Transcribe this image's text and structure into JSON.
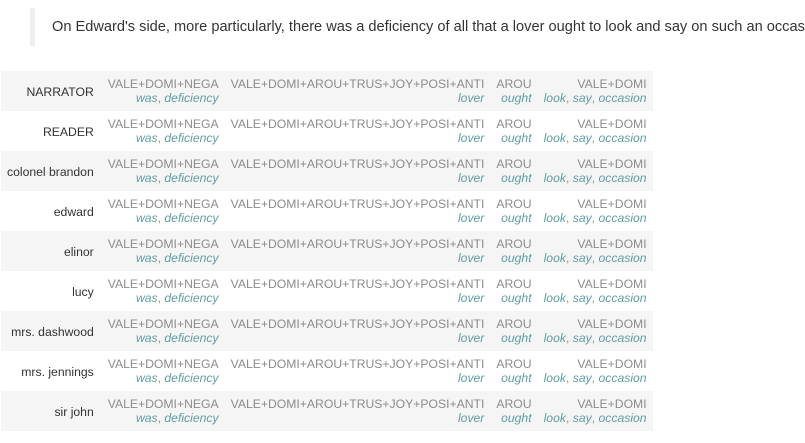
{
  "sentence": "On Edward's side, more particularly, there was a deficiency of all that a lover ought to look and say on such an occasion.",
  "columns": [
    {
      "labels": "VALE+DOMI+NEGA",
      "words": [
        "was",
        "deficiency"
      ]
    },
    {
      "labels": "VALE+DOMI+AROU+TRUS+JOY+POSI+ANTI",
      "words": [
        "lover"
      ]
    },
    {
      "labels": "AROU",
      "words": [
        "ought"
      ]
    },
    {
      "labels": "VALE+DOMI",
      "words": [
        "look",
        "say",
        "occasion"
      ]
    }
  ],
  "rows": [
    {
      "character": "NARRATOR"
    },
    {
      "character": "READER"
    },
    {
      "character": "colonel brandon"
    },
    {
      "character": "edward"
    },
    {
      "character": "elinor"
    },
    {
      "character": "lucy"
    },
    {
      "character": "mrs. dashwood"
    },
    {
      "character": "mrs. jennings"
    },
    {
      "character": "sir john"
    }
  ],
  "colors": {
    "label_gray": "#8c8c8c",
    "word_teal": "#5f9ea0",
    "row_stripe": "#f5f5f5",
    "quote_border": "#eeeeee"
  }
}
